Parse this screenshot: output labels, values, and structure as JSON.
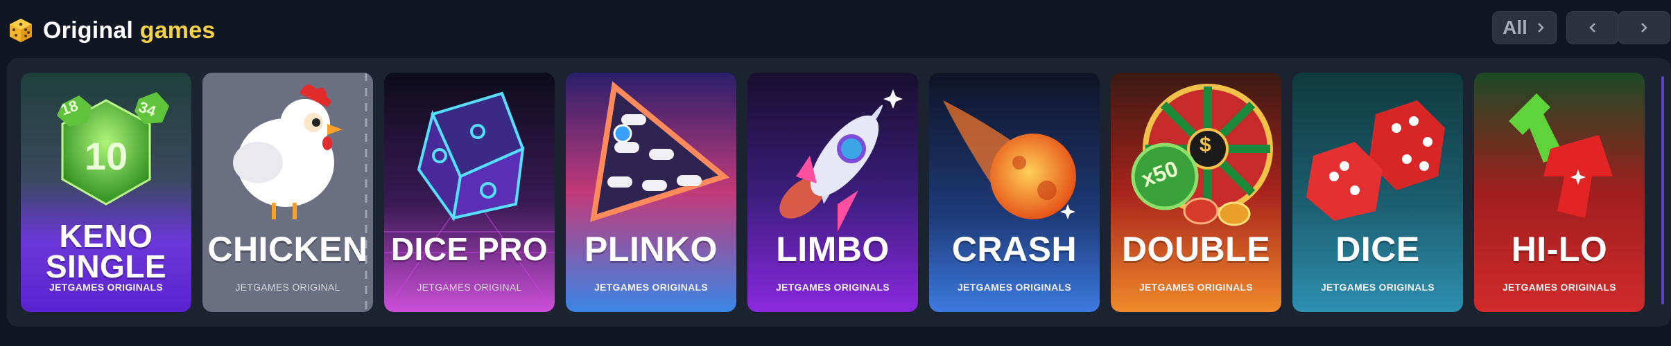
{
  "header": {
    "title_part1": "Original",
    "title_part2": "games",
    "icon": "dice-icon",
    "controls": {
      "all_label": "All",
      "prev_icon": "chevron-left-icon",
      "next_icon": "chevron-right-icon"
    }
  },
  "games": [
    {
      "name_line1": "KENO",
      "name_line2": "SINGLE",
      "subtitle": "JETGAMES ORIGINALS"
    },
    {
      "name_line1": "CHICKEN",
      "subtitle": "JETGAMES ORIGINAL"
    },
    {
      "name_line1": "DICE PRO",
      "subtitle": "JETGAMES ORIGINAL"
    },
    {
      "name_line1": "PLINKO",
      "subtitle": "JETGAMES ORIGINALS"
    },
    {
      "name_line1": "LIMBO",
      "subtitle": "JETGAMES ORIGINALS"
    },
    {
      "name_line1": "CRASH",
      "subtitle": "JETGAMES ORIGINALS"
    },
    {
      "name_line1": "DOUBLE",
      "subtitle": "JETGAMES ORIGINALS"
    },
    {
      "name_line1": "DICE",
      "subtitle": "JETGAMES ORIGINALS"
    },
    {
      "name_line1": "HI-LO",
      "subtitle": "JETGAMES ORIGINALS"
    }
  ],
  "art_text": {
    "keno_center": "10",
    "keno_left": "18",
    "keno_right": "34",
    "double_multiplier": "x50",
    "double_symbol": "$"
  },
  "colors": {
    "background": "#111722",
    "panel": "#1b2330",
    "accent_yellow": "#f6d24a"
  }
}
